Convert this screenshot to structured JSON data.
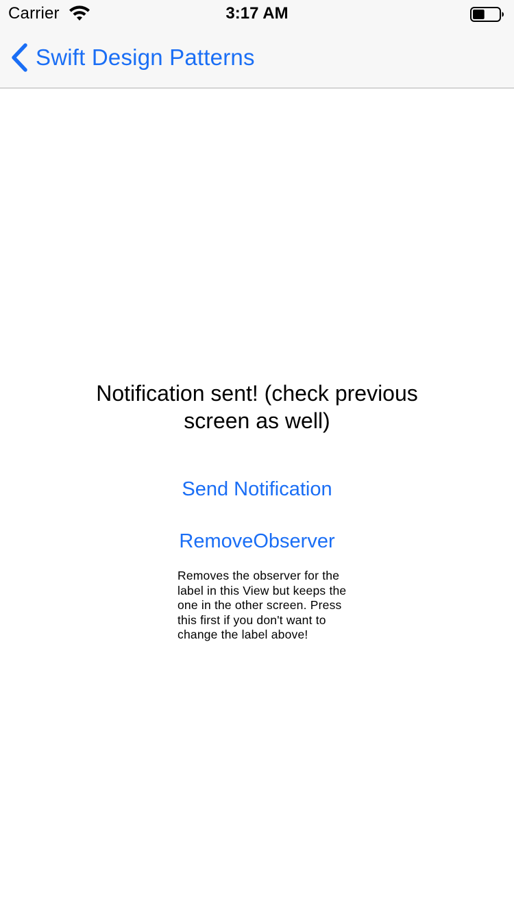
{
  "status_bar": {
    "carrier": "Carrier",
    "time": "3:17 AM",
    "wifi_icon": "wifi-icon",
    "battery_icon": "battery-icon",
    "battery_level": 0.45
  },
  "nav_bar": {
    "back_label": "Swift Design Patterns",
    "back_icon": "chevron-left-icon"
  },
  "main": {
    "status_message": "Notification sent! (check previous screen as well)",
    "send_button_label": "Send Notification",
    "remove_button_label": "RemoveObserver",
    "help_text": "Removes the observer for the label in this View but keeps the one in the other screen. Press this first if you don't want to change the label above!"
  },
  "colors": {
    "accent": "#1a6ef5",
    "bar_background": "#f7f7f7",
    "text": "#000000"
  }
}
